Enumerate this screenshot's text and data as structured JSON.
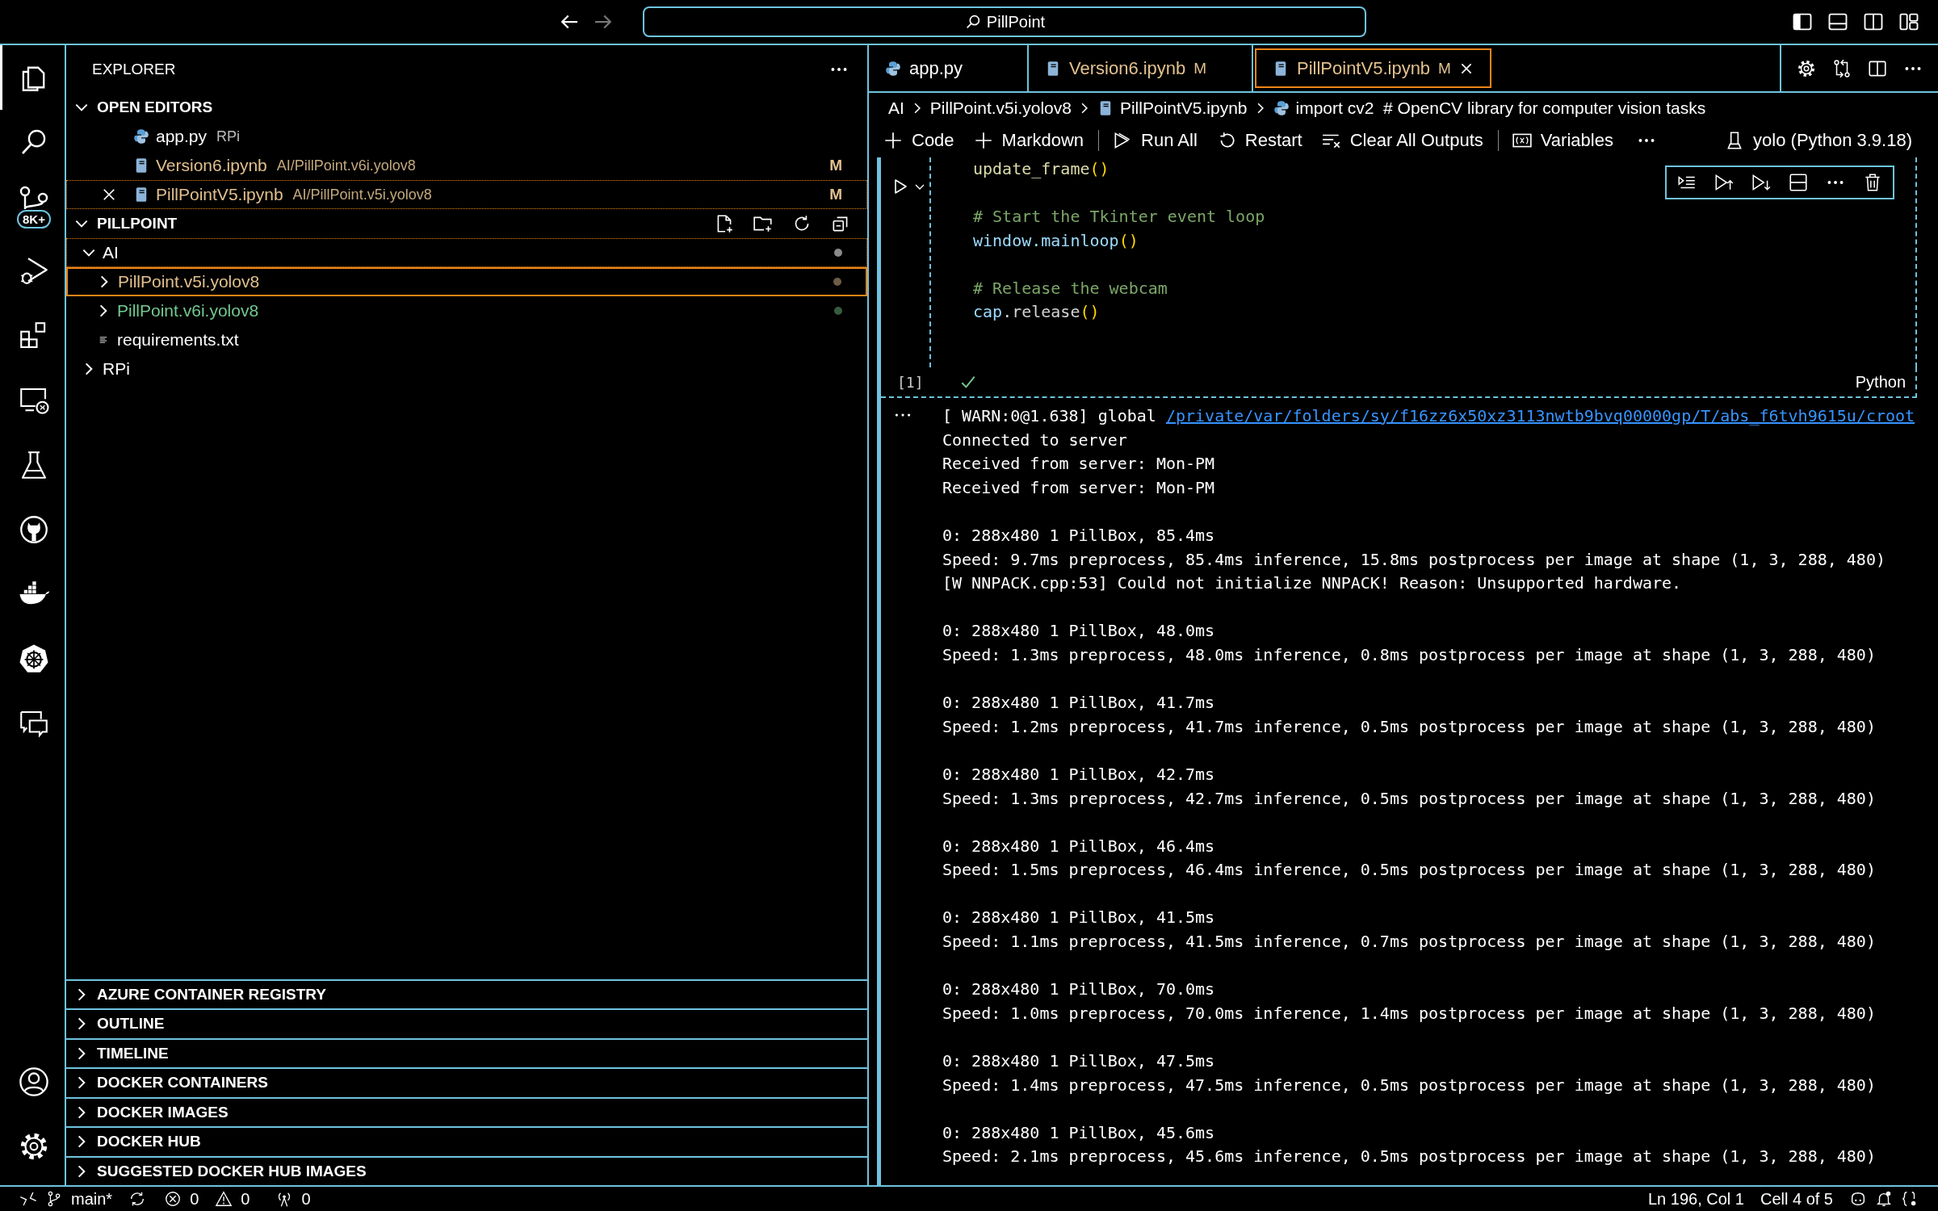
{
  "title_bar": {
    "search": "PillPoint"
  },
  "activity_bar": {
    "items": [
      {
        "kind": "files",
        "selected": true
      },
      {
        "kind": "search",
        "selected": false
      },
      {
        "kind": "source-control",
        "selected": false,
        "badge": "8K+"
      },
      {
        "kind": "run-debug",
        "selected": false
      },
      {
        "kind": "extensions",
        "selected": false
      },
      {
        "kind": "remote",
        "selected": false
      },
      {
        "kind": "testing",
        "selected": false
      },
      {
        "kind": "github",
        "selected": false
      },
      {
        "kind": "docker",
        "selected": false
      },
      {
        "kind": "kubernetes",
        "selected": false
      },
      {
        "kind": "chat",
        "selected": false
      }
    ],
    "bottom_items": [
      {
        "kind": "account"
      },
      {
        "kind": "settings"
      }
    ]
  },
  "sidebar": {
    "title": "EXPLORER",
    "open_editors": {
      "title": "OPEN EDITORS",
      "expanded": true,
      "items": [
        {
          "name": "app.py",
          "path": "RPi",
          "kind": "python",
          "modified": false,
          "selected": false
        },
        {
          "name": "Version6.ipynb",
          "path": "AI/PillPoint.v6i.yolov8",
          "kind": "notebook",
          "modified": true,
          "badge": "M",
          "selected": false
        },
        {
          "name": "PillPointV5.ipynb",
          "path": "AI/PillPoint.v5i.yolov8",
          "kind": "notebook",
          "modified": true,
          "badge": "M",
          "selected": true
        }
      ]
    },
    "project": {
      "title": "PILLPOINT",
      "expanded": true,
      "tree": [
        {
          "name": "AI",
          "kind": "folder",
          "expanded": true,
          "selected": false,
          "modified": false,
          "untracked": false,
          "color": "#8a8a8a",
          "children": [
            {
              "name": "PillPoint.v5i.yolov8",
              "kind": "folder",
              "expanded": false,
              "selected": true,
              "modified": true,
              "untracked": false,
              "color": "#6e5c45"
            },
            {
              "name": "PillPoint.v6i.yolov8",
              "kind": "folder",
              "expanded": false,
              "selected": false,
              "modified": false,
              "untracked": true,
              "color": "#365c3e"
            },
            {
              "name": "requirements.txt",
              "kind": "text",
              "selected": false,
              "modified": false,
              "untracked": false
            }
          ]
        },
        {
          "name": "RPi",
          "kind": "folder",
          "expanded": false,
          "selected": false,
          "modified": false,
          "untracked": false
        }
      ]
    },
    "panels": [
      {
        "title": "AZURE CONTAINER REGISTRY",
        "expanded": false
      },
      {
        "title": "OUTLINE",
        "expanded": false
      },
      {
        "title": "TIMELINE",
        "expanded": false
      },
      {
        "title": "DOCKER CONTAINERS",
        "expanded": false
      },
      {
        "title": "DOCKER IMAGES",
        "expanded": false
      },
      {
        "title": "DOCKER HUB",
        "expanded": false
      },
      {
        "title": "SUGGESTED DOCKER HUB IMAGES",
        "expanded": false
      }
    ]
  },
  "editor": {
    "tabs": [
      {
        "label": "app.py",
        "kind": "python",
        "modified": false,
        "selected": false
      },
      {
        "label": "Version6.ipynb",
        "kind": "notebook",
        "modified": true,
        "badge": "M",
        "selected": false
      },
      {
        "label": "PillPointV5.ipynb",
        "kind": "notebook",
        "modified": true,
        "badge": "M",
        "selected": true
      }
    ],
    "breadcrumbs": [
      {
        "label": "AI",
        "kind": "folder"
      },
      {
        "label": "PillPoint.v5i.yolov8",
        "kind": "folder"
      },
      {
        "label": "PillPointV5.ipynb",
        "kind": "notebook"
      },
      {
        "label": "import cv2  # OpenCV library for computer vision tasks",
        "kind": "python"
      }
    ],
    "toolbar": [
      {
        "label": "Code",
        "kind": "plus",
        "divider": false
      },
      {
        "label": "Markdown",
        "kind": "plus",
        "divider": false
      },
      {
        "label": "Run All",
        "kind": "run-all",
        "divider": true
      },
      {
        "label": "Restart",
        "kind": "restart",
        "divider": false
      },
      {
        "label": "Clear All Outputs",
        "kind": "clear",
        "divider": false
      },
      {
        "label": "Variables",
        "kind": "variables",
        "divider": true
      }
    ],
    "kernel": "yolo (Python 3.9.18)",
    "cell": {
      "execution": "[1]",
      "success": true,
      "language": "Python",
      "blocks": [
        [
          [
            {
              "t": "update_frame",
              "color": "#dcdcaa"
            },
            {
              "t": "()",
              "color": "#ffd700"
            }
          ]
        ],
        [
          [
            {
              "t": "# Start the Tkinter event loop",
              "color": "#7ca668"
            }
          ],
          [
            {
              "t": "window.mainloop",
              "color": "#9cdcfe"
            },
            {
              "t": "()",
              "color": "#ffd700"
            }
          ]
        ],
        [
          [
            {
              "t": "# Release the webcam",
              "color": "#7ca668"
            }
          ],
          [
            {
              "t": "cap",
              "color": "#9cdcfe"
            },
            {
              "t": ".release",
              "color": "#d4d4d4"
            },
            {
              "t": "()",
              "color": "#ffd700"
            }
          ]
        ]
      ]
    },
    "output": {
      "warn_prefix": "[ WARN:0@1.638] global ",
      "warn_link": "/private/var/folders/sy/f16zz6x50xz3113nwtb9bvq00000gp/T/abs_f6tvh9615u/croot",
      "blocks": [
        [
          "Connected to server",
          "Received from server: Mon-PM",
          "Received from server: Mon-PM"
        ],
        [
          "0: 288x480 1 PillBox, 85.4ms",
          "Speed: 9.7ms preprocess, 85.4ms inference, 15.8ms postprocess per image at shape (1, 3, 288, 480)",
          "[W NNPACK.cpp:53] Could not initialize NNPACK! Reason: Unsupported hardware."
        ],
        [
          "0: 288x480 1 PillBox, 48.0ms",
          "Speed: 1.3ms preprocess, 48.0ms inference, 0.8ms postprocess per image at shape (1, 3, 288, 480)"
        ],
        [
          "0: 288x480 1 PillBox, 41.7ms",
          "Speed: 1.2ms preprocess, 41.7ms inference, 0.5ms postprocess per image at shape (1, 3, 288, 480)"
        ],
        [
          "0: 288x480 1 PillBox, 42.7ms",
          "Speed: 1.3ms preprocess, 42.7ms inference, 0.5ms postprocess per image at shape (1, 3, 288, 480)"
        ],
        [
          "0: 288x480 1 PillBox, 46.4ms",
          "Speed: 1.5ms preprocess, 46.4ms inference, 0.5ms postprocess per image at shape (1, 3, 288, 480)"
        ],
        [
          "0: 288x480 1 PillBox, 41.5ms",
          "Speed: 1.1ms preprocess, 41.5ms inference, 0.7ms postprocess per image at shape (1, 3, 288, 480)"
        ],
        [
          "0: 288x480 1 PillBox, 70.0ms",
          "Speed: 1.0ms preprocess, 70.0ms inference, 1.4ms postprocess per image at shape (1, 3, 288, 480)"
        ],
        [
          "0: 288x480 1 PillBox, 47.5ms",
          "Speed: 1.4ms preprocess, 47.5ms inference, 0.5ms postprocess per image at shape (1, 3, 288, 480)"
        ],
        [
          "0: 288x480 1 PillBox, 45.6ms",
          "Speed: 2.1ms preprocess, 45.6ms inference, 0.5ms postprocess per image at shape (1, 3, 288, 480)"
        ]
      ]
    }
  },
  "status_bar": {
    "branch": "main*",
    "errors": "0",
    "warnings": "0",
    "ports": "0",
    "position": "Ln 196, Col 1",
    "cell": "Cell 4 of 5"
  }
}
